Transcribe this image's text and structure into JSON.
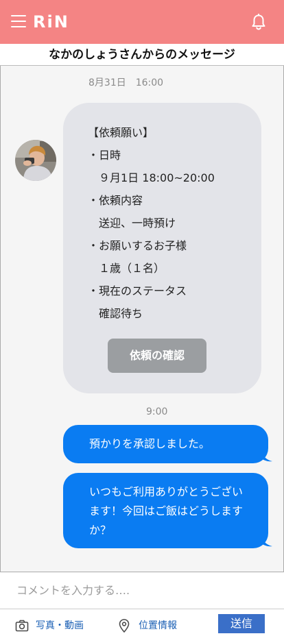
{
  "header": {
    "logo": "RiN",
    "menu_icon": "hamburger-menu-icon",
    "bell_icon": "bell-icon",
    "bg_color": "#f48484"
  },
  "thread": {
    "title": "なかのしょうさんからのメッセージ"
  },
  "messages": {
    "first_timestamp": "8月31日　16:00",
    "request": {
      "lines": [
        "【依頼願い】",
        "・日時",
        "　９月1日 18:00~20:00",
        "・依頼内容",
        "　送迎、一時預け",
        "・お願いするお子様",
        "　１歳（１名）",
        "・現在のステータス",
        "　確認待ち"
      ],
      "button_label": "依頼の確認"
    },
    "second_timestamp": "9:00",
    "outgoing": [
      "預かりを承認しました。",
      "いつもご利用ありがとうございます！今回はご飯はどうしますか？"
    ],
    "incoming_color": "#e3e4e9",
    "outgoing_color": "#0a7cf2"
  },
  "composer": {
    "placeholder": "コメントを入力する….",
    "value": "",
    "photo_label": "写真・動画",
    "photo_icon": "camera-icon",
    "location_label": "位置情報",
    "location_icon": "location-pin-icon",
    "send_label": "送信"
  }
}
